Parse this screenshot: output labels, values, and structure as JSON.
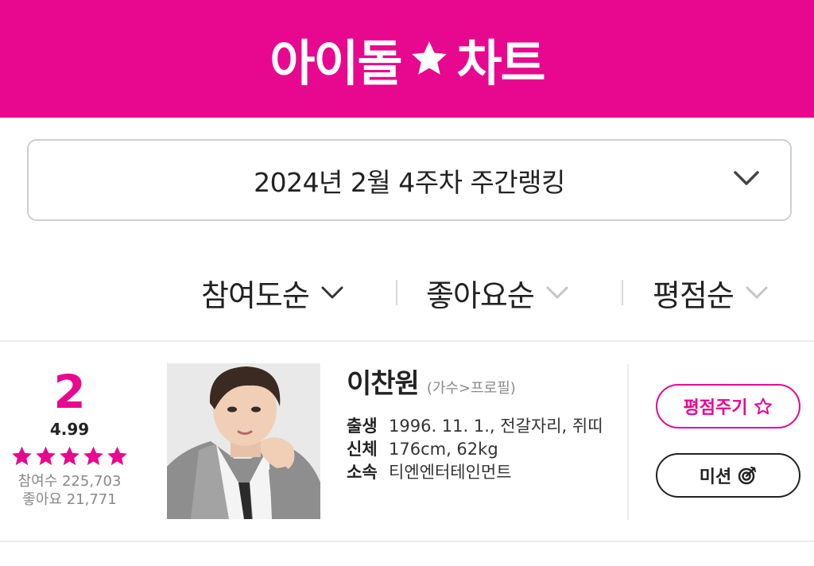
{
  "header": {
    "logo_left": "아이돌",
    "logo_right": "차트",
    "logo_icon": "star-icon",
    "brand_color": "#e8078f"
  },
  "week_select": {
    "label": "2024년 2월 4주차 주간랭킹",
    "icon": "chevron-down-icon"
  },
  "sort": {
    "items": [
      {
        "label": "참여도순",
        "active": true
      },
      {
        "label": "좋아요순",
        "active": false
      },
      {
        "label": "평점순",
        "active": false
      }
    ]
  },
  "entry": {
    "rank": "2",
    "rating": "4.99",
    "stars_filled": 5,
    "participants": "참여수 225,703",
    "likes": "좋아요 21,771",
    "name": "이찬원",
    "profile_link": "(가수>프로필)",
    "details": [
      {
        "key": "출생",
        "value": "1996. 11. 1., 전갈자리, 쥐띠"
      },
      {
        "key": "신체",
        "value": "176cm, 62kg"
      },
      {
        "key": "소속",
        "value": "티엔엔터테인먼트"
      }
    ],
    "rate_button": "평점주기",
    "mission_button": "미션"
  }
}
